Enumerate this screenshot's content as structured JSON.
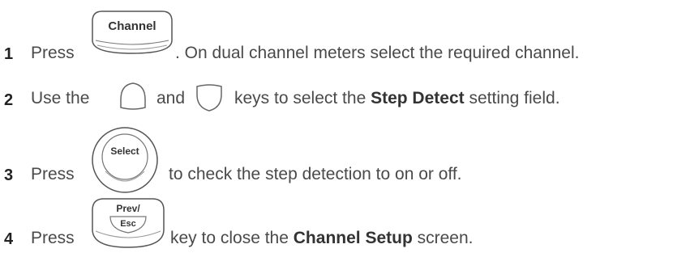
{
  "steps": [
    {
      "number": "1",
      "before": "Press",
      "key_label": "Channel",
      "key_icon": "channel-key-icon",
      "after": ". On dual channel meters select the required channel."
    },
    {
      "number": "2",
      "before": "Use the",
      "up_key_icon": "up-arrow-key-icon",
      "middle": "and",
      "down_key_icon": "down-arrow-key-icon",
      "after_pre": "keys to select the",
      "bold": "Step Detect",
      "after_post": "setting field."
    },
    {
      "number": "3",
      "before": "Press",
      "key_label": "Select",
      "key_icon": "select-key-icon",
      "after": "to check the step detection to on or off."
    },
    {
      "number": "4",
      "before": "Press",
      "key_label_line1": "Prev/",
      "key_label_line2": "Esc",
      "key_icon": "prev-esc-key-icon",
      "after_pre": "key to close the",
      "bold": "Channel Setup",
      "after_post": "screen."
    }
  ]
}
